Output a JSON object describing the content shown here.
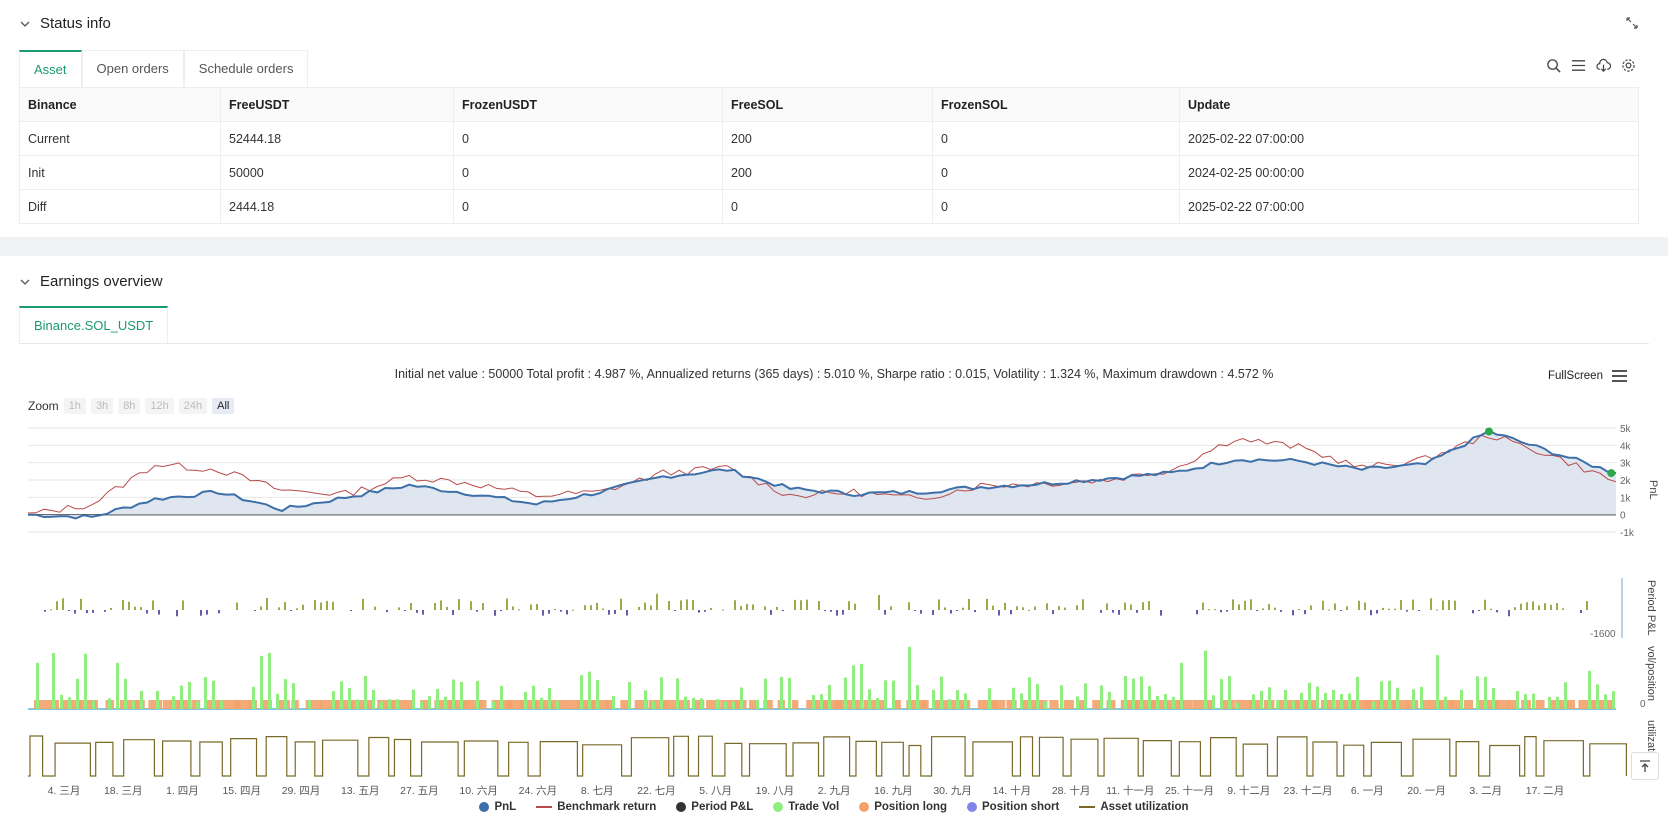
{
  "status": {
    "title": "Status info",
    "tabs": [
      "Asset",
      "Open orders",
      "Schedule orders"
    ],
    "table": {
      "headers": [
        "Binance",
        "FreeUSDT",
        "FrozenUSDT",
        "FreeSOL",
        "FrozenSOL",
        "Update"
      ],
      "rows": [
        [
          "Current",
          "52444.18",
          "0",
          "200",
          "0",
          "2025-02-22 07:00:00"
        ],
        [
          "Init",
          "50000",
          "0",
          "200",
          "0",
          "2024-02-25 00:00:00"
        ],
        [
          "Diff",
          "2444.18",
          "0",
          "0",
          "0",
          "2025-02-22 07:00:00"
        ]
      ]
    }
  },
  "earnings": {
    "title": "Earnings overview",
    "tab": "Binance.SOL_USDT",
    "summary": "Initial net value : 50000 Total profit : 4.987 %, Annualized returns (365 days) : 5.010 %, Sharpe ratio : 0.015, Volatility : 1.324 %, Maximum drawdown : 4.572 %",
    "fullscreen": "FullScreen",
    "zoom_label": "Zoom",
    "zoom_buttons": [
      "1h",
      "3h",
      "8h",
      "12h",
      "24h",
      "All"
    ]
  },
  "colors": {
    "accent": "#1a9a6e",
    "pnl": "#3d6fa8",
    "benchmark": "#b84a4a",
    "period_pos": "#9aab4a",
    "period_neg": "#6a5aa8",
    "trade_vol": "#90ee7e",
    "position_long": "#f4a26a",
    "position_short": "#8085e9",
    "utilization": "#7a6a2a"
  },
  "chart_data": {
    "type": "line",
    "x_ticks": [
      "4. 三月",
      "18. 三月",
      "1. 四月",
      "15. 四月",
      "29. 四月",
      "13. 五月",
      "27. 五月",
      "10. 六月",
      "24. 六月",
      "8. 七月",
      "22. 七月",
      "5. 八月",
      "19. 八月",
      "2. 九月",
      "16. 九月",
      "30. 九月",
      "14. 十月",
      "28. 十月",
      "11. 十一月",
      "25. 十一月",
      "9. 十二月",
      "23. 十二月",
      "6. 一月",
      "20. 一月",
      "3. 二月",
      "17. 二月"
    ],
    "panes": [
      {
        "name": "PnL",
        "y_ticks": [
          "5k",
          "4k",
          "3k",
          "2k",
          "1k",
          "0",
          "-1k"
        ],
        "ylim": [
          -1000,
          5000
        ]
      },
      {
        "name": "Period P&L",
        "y_ticks": [
          "-1600"
        ]
      },
      {
        "name": "vol/position",
        "y_ticks": [
          "0"
        ]
      },
      {
        "name": "utilization",
        "y_ticks": [
          "0"
        ]
      }
    ],
    "series": [
      {
        "name": "PnL",
        "x": [
          0,
          4,
          8,
          12,
          16,
          20,
          24,
          28,
          32,
          36,
          40,
          44,
          48,
          52,
          56,
          60,
          64,
          68,
          72,
          76,
          80,
          84,
          88,
          92,
          96,
          100
        ],
        "values": [
          0,
          -150,
          900,
          1300,
          300,
          1000,
          1700,
          1200,
          600,
          1300,
          2200,
          2600,
          1500,
          1200,
          1300,
          1600,
          1800,
          2100,
          2400,
          3200,
          3100,
          2600,
          2900,
          4800,
          3600,
          2400
        ]
      },
      {
        "name": "Benchmark return",
        "x": [
          0,
          4,
          8,
          12,
          16,
          20,
          24,
          28,
          32,
          36,
          40,
          44,
          48,
          52,
          56,
          60,
          64,
          68,
          72,
          76,
          80,
          84,
          88,
          92,
          96,
          100
        ],
        "values": [
          0,
          600,
          2900,
          2600,
          1400,
          1200,
          2200,
          1800,
          1100,
          1300,
          2400,
          2700,
          1100,
          1300,
          900,
          1700,
          1800,
          2000,
          2600,
          4400,
          3900,
          2700,
          3200,
          4600,
          3400,
          1900
        ]
      }
    ],
    "legend": [
      "PnL",
      "Benchmark return",
      "Period P&L",
      "Trade Vol",
      "Position long",
      "Position short",
      "Asset utilization"
    ]
  }
}
